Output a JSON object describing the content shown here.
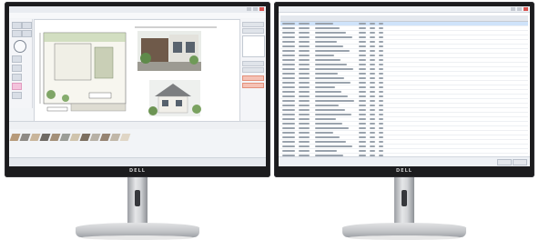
{
  "scene": "two-monitors",
  "left_monitor": {
    "brand": "DELL",
    "app": {
      "title": "",
      "swatch_colors": [
        "#b79a7a",
        "#8e8a85",
        "#c9b59b",
        "#6f6a64",
        "#a38f78",
        "#9b9d97",
        "#d0c4ad",
        "#7c6f60",
        "#b8b1a6",
        "#968472",
        "#c1b7a8",
        "#e0d6c6"
      ]
    }
  },
  "right_monitor": {
    "brand": "DELL",
    "table": {
      "row_count": 41,
      "selected_row": 0
    }
  }
}
